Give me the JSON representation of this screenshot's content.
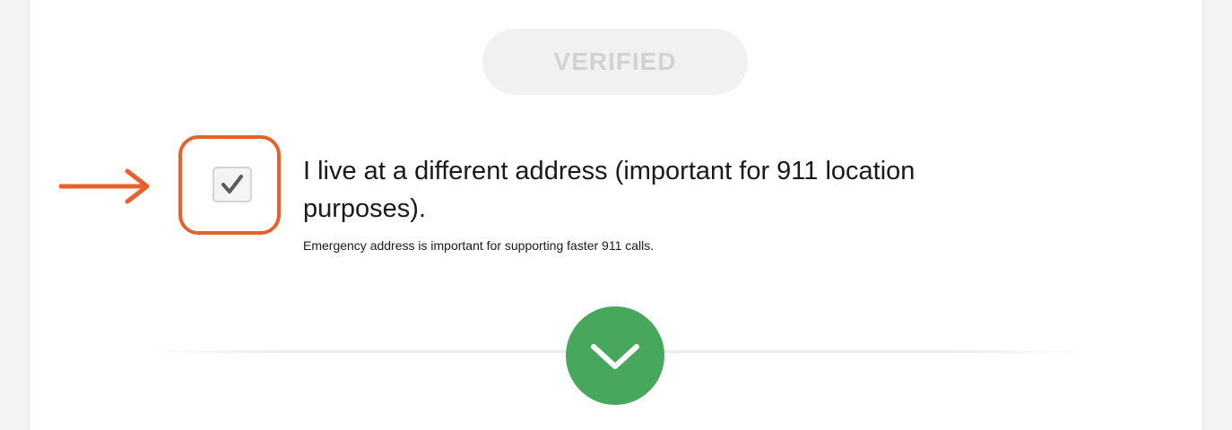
{
  "status": {
    "verified_label": "VERIFIED"
  },
  "address_option": {
    "label": "I live at a different address (important for 911 location purposes).",
    "hint": "Emergency address is important for supporting faster 911 calls.",
    "checked": true
  },
  "annotation": {
    "color": "#e8612c"
  },
  "icons": {
    "checkbox": "checkmark-icon",
    "next": "chevron-down-icon",
    "pointer": "arrow-right-icon"
  },
  "colors": {
    "accent_green": "#47a85d",
    "highlight_orange": "#e8612c",
    "verified_text": "#d2d2d2"
  }
}
